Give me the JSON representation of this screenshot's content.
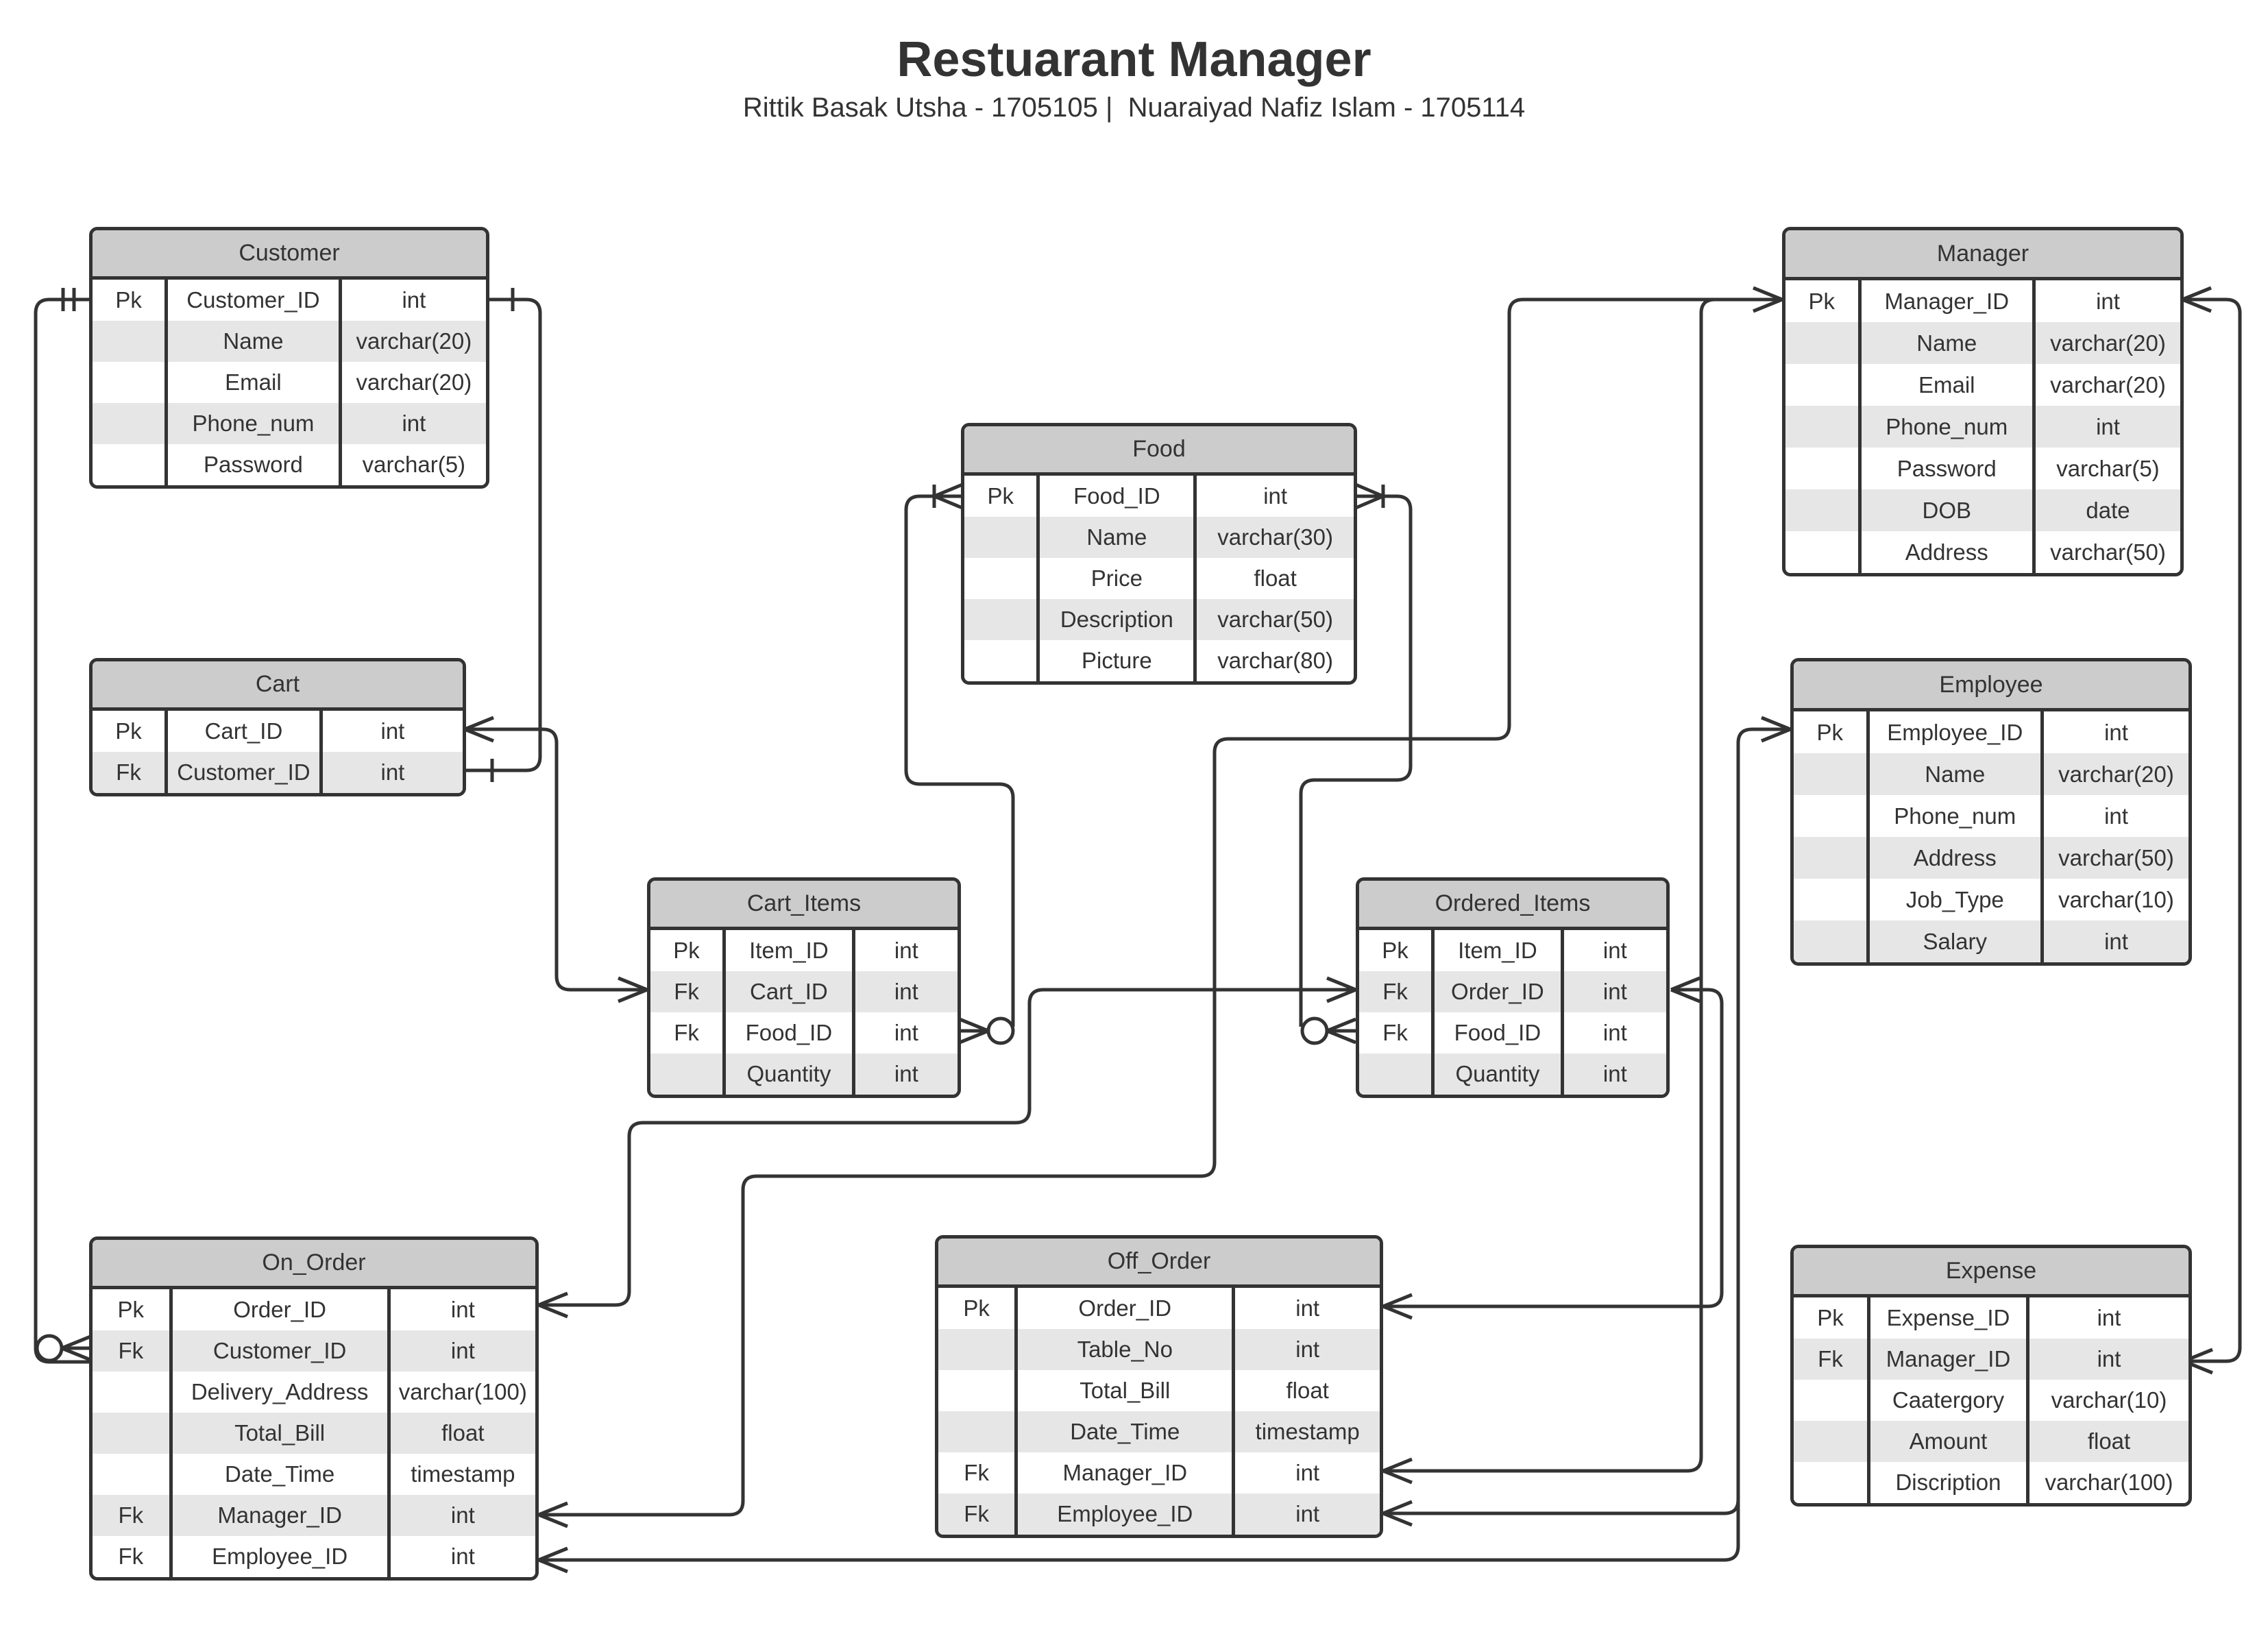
{
  "title": "Restuarant Manager",
  "subtitle": "Rittik Basak Utsha - 1705105 |  Nuaraiyad Nafiz Islam - 1705114",
  "colors": {
    "stroke": "#333333",
    "header": "#cccccc",
    "stripe": "#e6e6e6"
  },
  "entities": {
    "customer": {
      "name": "Customer",
      "rows": [
        [
          "Pk",
          "Customer_ID",
          "int"
        ],
        [
          "",
          "Name",
          "varchar(20)"
        ],
        [
          "",
          "Email",
          "varchar(20)"
        ],
        [
          "",
          "Phone_num",
          "int"
        ],
        [
          "",
          "Password",
          "varchar(5)"
        ]
      ]
    },
    "cart": {
      "name": "Cart",
      "rows": [
        [
          "Pk",
          "Cart_ID",
          "int"
        ],
        [
          "Fk",
          "Customer_ID",
          "int"
        ]
      ]
    },
    "food": {
      "name": "Food",
      "rows": [
        [
          "Pk",
          "Food_ID",
          "int"
        ],
        [
          "",
          "Name",
          "varchar(30)"
        ],
        [
          "",
          "Price",
          "float"
        ],
        [
          "",
          "Description",
          "varchar(50)"
        ],
        [
          "",
          "Picture",
          "varchar(80)"
        ]
      ]
    },
    "manager": {
      "name": "Manager",
      "rows": [
        [
          "Pk",
          "Manager_ID",
          "int"
        ],
        [
          "",
          "Name",
          "varchar(20)"
        ],
        [
          "",
          "Email",
          "varchar(20)"
        ],
        [
          "",
          "Phone_num",
          "int"
        ],
        [
          "",
          "Password",
          "varchar(5)"
        ],
        [
          "",
          "DOB",
          "date"
        ],
        [
          "",
          "Address",
          "varchar(50)"
        ]
      ]
    },
    "employee": {
      "name": "Employee",
      "rows": [
        [
          "Pk",
          "Employee_ID",
          "int"
        ],
        [
          "",
          "Name",
          "varchar(20)"
        ],
        [
          "",
          "Phone_num",
          "int"
        ],
        [
          "",
          "Address",
          "varchar(50)"
        ],
        [
          "",
          "Job_Type",
          "varchar(10)"
        ],
        [
          "",
          "Salary",
          "int"
        ]
      ]
    },
    "cart_items": {
      "name": "Cart_Items",
      "rows": [
        [
          "Pk",
          "Item_ID",
          "int"
        ],
        [
          "Fk",
          "Cart_ID",
          "int"
        ],
        [
          "Fk",
          "Food_ID",
          "int"
        ],
        [
          "",
          "Quantity",
          "int"
        ]
      ]
    },
    "ordered_items": {
      "name": "Ordered_Items",
      "rows": [
        [
          "Pk",
          "Item_ID",
          "int"
        ],
        [
          "Fk",
          "Order_ID",
          "int"
        ],
        [
          "Fk",
          "Food_ID",
          "int"
        ],
        [
          "",
          "Quantity",
          "int"
        ]
      ]
    },
    "on_order": {
      "name": "On_Order",
      "rows": [
        [
          "Pk",
          "Order_ID",
          "int"
        ],
        [
          "Fk",
          "Customer_ID",
          "int"
        ],
        [
          "",
          "Delivery_Address",
          "varchar(100)"
        ],
        [
          "",
          "Total_Bill",
          "float"
        ],
        [
          "",
          "Date_Time",
          "timestamp"
        ],
        [
          "Fk",
          "Manager_ID",
          "int"
        ],
        [
          "Fk",
          "Employee_ID",
          "int"
        ]
      ]
    },
    "off_order": {
      "name": "Off_Order",
      "rows": [
        [
          "Pk",
          "Order_ID",
          "int"
        ],
        [
          "",
          "Table_No",
          "int"
        ],
        [
          "",
          "Total_Bill",
          "float"
        ],
        [
          "",
          "Date_Time",
          "timestamp"
        ],
        [
          "Fk",
          "Manager_ID",
          "int"
        ],
        [
          "Fk",
          "Employee_ID",
          "int"
        ]
      ]
    },
    "expense": {
      "name": "Expense",
      "rows": [
        [
          "Pk",
          "Expense_ID",
          "int"
        ],
        [
          "Fk",
          "Manager_ID",
          "int"
        ],
        [
          "",
          "Caatergory",
          "varchar(10)"
        ],
        [
          "",
          "Amount",
          "float"
        ],
        [
          "",
          "Discription",
          "varchar(100)"
        ]
      ]
    }
  }
}
